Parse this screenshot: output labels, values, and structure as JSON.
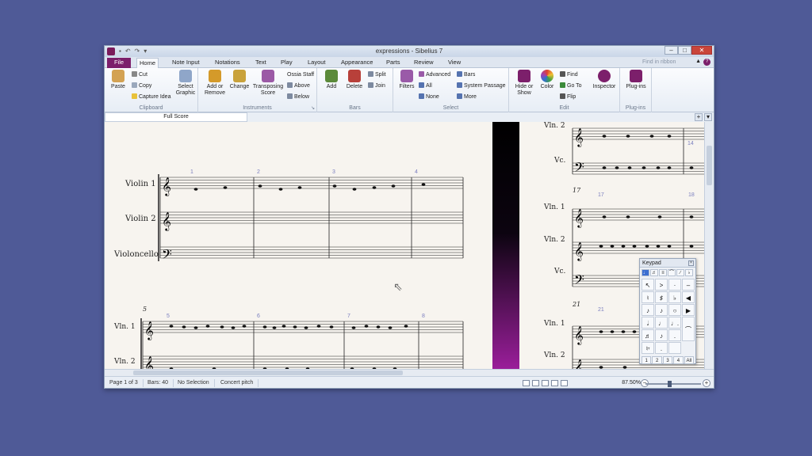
{
  "window": {
    "title": "expressions - Sibelius 7",
    "controls": [
      "–",
      "□",
      "✕"
    ]
  },
  "tabs": [
    {
      "label": "File"
    },
    {
      "label": "Home"
    },
    {
      "label": "Note Input"
    },
    {
      "label": "Notations"
    },
    {
      "label": "Text"
    },
    {
      "label": "Play"
    },
    {
      "label": "Layout"
    },
    {
      "label": "Appearance"
    },
    {
      "label": "Parts"
    },
    {
      "label": "Review"
    },
    {
      "label": "View"
    }
  ],
  "active_tab": "Home",
  "ribbon_search": {
    "placeholder": "Find in ribbon"
  },
  "ribbon": {
    "clipboard": {
      "label": "Clipboard",
      "paste": "Paste",
      "cut": "Cut",
      "copy": "Copy",
      "capture_idea": "Capture Idea",
      "select_graphic": "Select Graphic"
    },
    "instruments": {
      "label": "Instruments",
      "add_or_remove": "Add or Remove",
      "change": "Change",
      "transposing_score": "Transposing Score",
      "ossia_staff": "Ossia Staff",
      "above": "Above",
      "below": "Below"
    },
    "bars": {
      "label": "Bars",
      "add": "Add",
      "delete": "Delete",
      "split": "Split",
      "join": "Join"
    },
    "select": {
      "label": "Select",
      "filters": "Filters",
      "advanced": "Advanced",
      "all": "All",
      "none": "None",
      "bars": "Bars",
      "system_passage": "System Passage",
      "more": "More"
    },
    "edit": {
      "label": "Edit",
      "hide_or_show": "Hide or Show",
      "color": "Color",
      "find": "Find",
      "go_to": "Go To",
      "flip": "Flip",
      "inspector": "Inspector"
    },
    "plugins": {
      "label": "Plug-ins",
      "plugins": "Plug-ins"
    }
  },
  "document_tab": "Full Score",
  "score": {
    "left_page": {
      "system1": {
        "staff_names": [
          "Violin 1",
          "Violin 2",
          "Violoncello"
        ],
        "bar_numbers": [
          "1",
          "2",
          "3",
          "4"
        ],
        "time_signature": "6/8"
      },
      "system2": {
        "system_number": "5",
        "staff_names": [
          "Vln. 1",
          "Vln. 2",
          "Vc."
        ],
        "bar_numbers": [
          "5",
          "6",
          "7",
          "8"
        ]
      }
    },
    "right_page": {
      "system_a": {
        "staff_names": [
          "Vln. 2",
          "Vc."
        ],
        "bar_numbers": [
          "14"
        ]
      },
      "system_b": {
        "system_number": "17",
        "staff_names": [
          "Vln. 1",
          "Vln. 2",
          "Vc."
        ],
        "bar_numbers": [
          "17",
          "18"
        ]
      },
      "system_c": {
        "system_number": "21",
        "staff_names": [
          "Vln. 1",
          "Vln. 2"
        ],
        "bar_numbers": [
          "21"
        ]
      }
    }
  },
  "keypad": {
    "title": "Keypad",
    "layout_buttons": [
      "1",
      "2",
      "3",
      "4",
      "All"
    ]
  },
  "status_bar": {
    "page": "Page 1 of 3",
    "bars": "Bars: 40",
    "selection": "No Selection",
    "pitch": "Concert pitch",
    "zoom": "87.50%"
  }
}
